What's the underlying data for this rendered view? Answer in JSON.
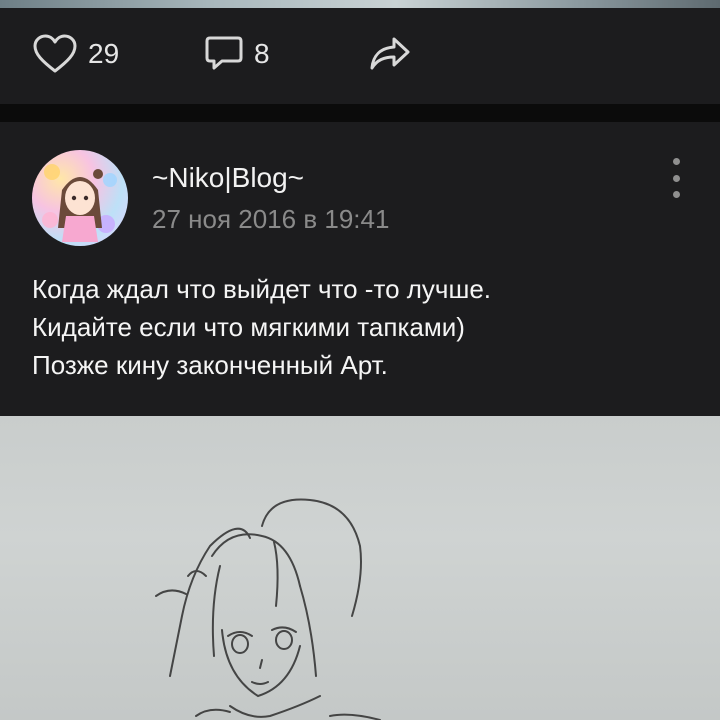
{
  "previous_post": {
    "likes_count": "29",
    "comments_count": "8"
  },
  "post": {
    "author": "~Niko|Blog~",
    "date": "27 ноя 2016 в 19:41",
    "text_lines": [
      "Когда ждал что выйдет что -то лучше.",
      "Кидайте если что мягкими тапками)",
      "Позже кину законченный Арт."
    ]
  },
  "icons": {
    "like": "heart-icon",
    "comment": "comment-icon",
    "share": "share-icon",
    "menu": "more-vertical-icon"
  },
  "colors": {
    "card_background": "#1c1c1e",
    "page_background": "#0b0b0b",
    "secondary_text": "#8a8a8a"
  }
}
